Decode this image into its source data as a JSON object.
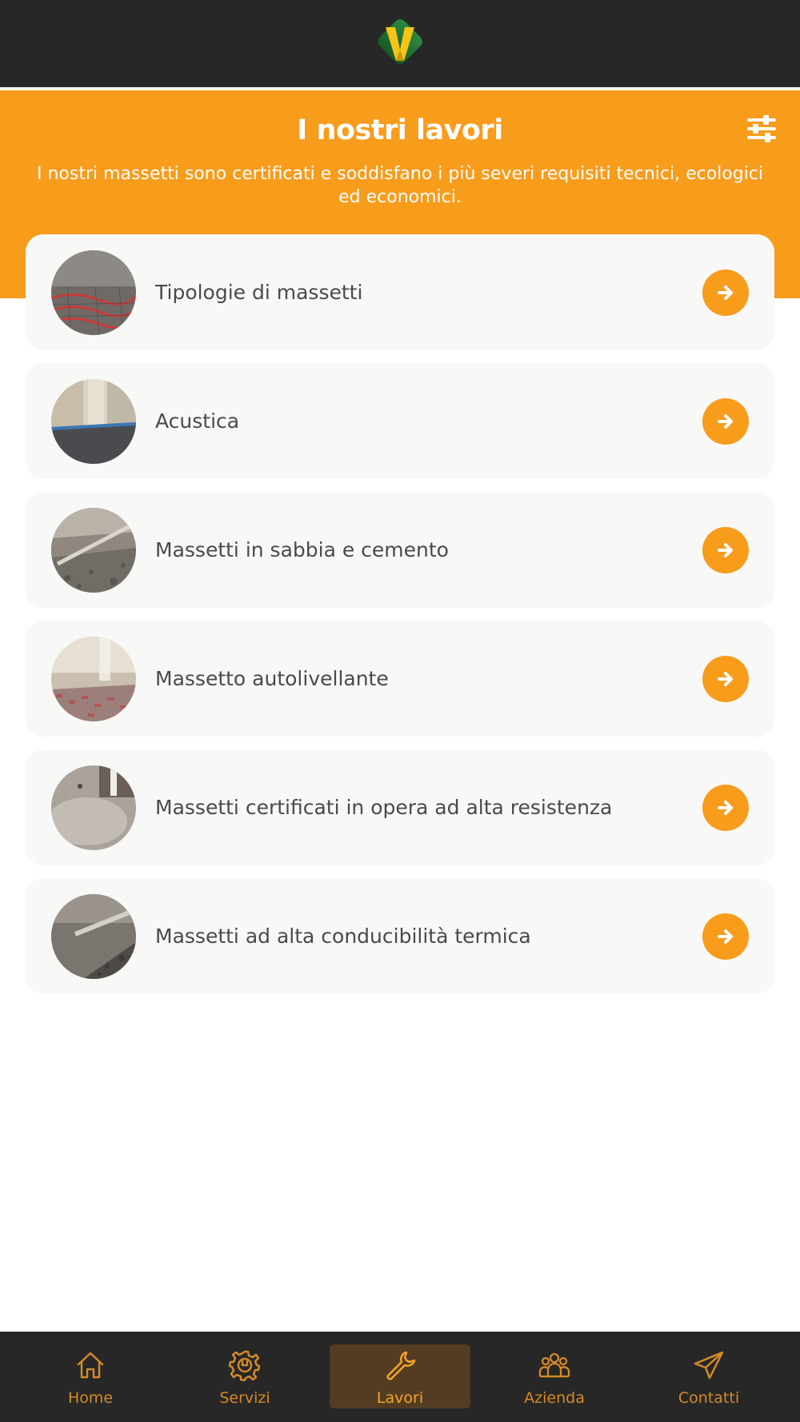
{
  "header": {
    "logo_icon": "v-diamond-logo",
    "colors": {
      "bar": "#272727",
      "logo_green": "#1f7a34",
      "logo_yellow": "#f5c417"
    }
  },
  "hero": {
    "title": "I nostri lavori",
    "subtitle": "I nostri massetti sono certificati e soddisfano i più severi requisiti tecnici, ecologici ed economici.",
    "filter_icon": "sliders-icon",
    "accent": "#f89c1c"
  },
  "items": [
    {
      "label": "Tipologie di massetti",
      "thumb_icon": "screed-heating-pipes-photo"
    },
    {
      "label": "Acustica",
      "thumb_icon": "room-floor-photo"
    },
    {
      "label": "Massetti in sabbia e cemento",
      "thumb_icon": "sand-cement-screed-photo"
    },
    {
      "label": "Massetto autolivellante",
      "thumb_icon": "self-leveling-screed-photo"
    },
    {
      "label": "Massetti certificati in opera ad alta resistenza",
      "thumb_icon": "high-strength-screed-photo"
    },
    {
      "label": "Massetti ad alta conducibilità termica",
      "thumb_icon": "thermal-screed-photo"
    }
  ],
  "tabs": [
    {
      "label": "Home",
      "icon": "home-icon",
      "active": false
    },
    {
      "label": "Servizi",
      "icon": "gear-wrench-icon",
      "active": false
    },
    {
      "label": "Lavori",
      "icon": "wrench-icon",
      "active": true
    },
    {
      "label": "Azienda",
      "icon": "people-icon",
      "active": false
    },
    {
      "label": "Contatti",
      "icon": "paper-plane-icon",
      "active": false
    }
  ]
}
